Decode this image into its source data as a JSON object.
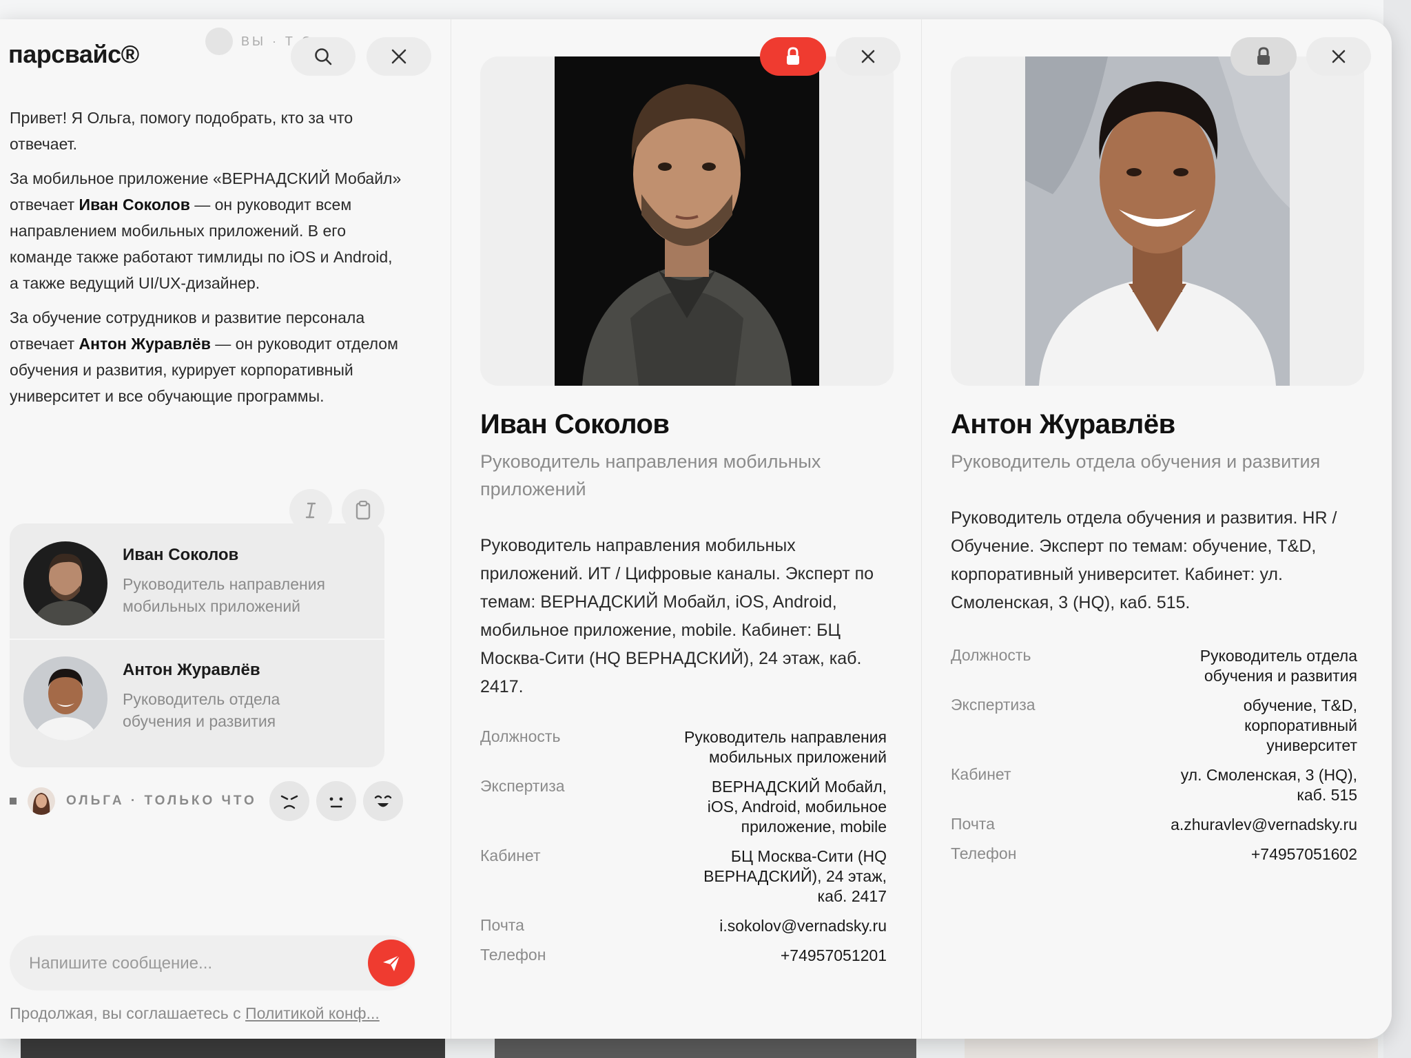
{
  "app": {
    "logo": "парсвайс®",
    "top_meta": "ВЫ · Т   О  ·"
  },
  "chat": {
    "messages": {
      "p1": "Привет! Я Ольга, помогу подобрать, кто за что отвечает.",
      "p2_a": "За мобильное приложение «ВЕРНАДСКИЙ Мобайл» отвечает ",
      "p2_b": "Иван Соколов",
      "p2_c": " — он руководит всем направлением мобильных приложений. В его команде также работают тимлиды по iOS и Android, а также ведущий UI/UX-дизайнер.",
      "p3_a": "За обучение сотрудников и развитие персонала отвечает ",
      "p3_b": "Антон Журавлёв",
      "p3_c": " — он руководит отделом обучения и развития, курирует корпоративный университет и все обучающие программы."
    },
    "cards": [
      {
        "name": "Иван Соколов",
        "role": "Руководитель направления мобильных приложений"
      },
      {
        "name": "Антон Журавлёв",
        "role": "Руководитель отдела обучения и развития"
      }
    ],
    "sender": "ОЛЬГА · ТОЛЬКО ЧТО",
    "input_placeholder": "Напишите сообщение...",
    "consent_text": "Продолжая, вы соглашаетесь с ",
    "consent_link": "Политикой конф..."
  },
  "profiles": [
    {
      "name": "Иван Соколов",
      "role": "Руководитель направления мобильных приложений",
      "description": "Руководитель направления мобильных приложений. ИТ / Цифровые каналы. Эксперт по темам: ВЕРНАДСКИЙ Мобайл, iOS, Android, мобильное приложение, mobile. Кабинет: БЦ Москва-Сити (HQ ВЕРНАДСКИЙ), 24 этаж, каб. 2417.",
      "fields": [
        {
          "label": "Должность",
          "value": "Руководитель направления мобильных приложений"
        },
        {
          "label": "Экспертиза",
          "value": "ВЕРНАДСКИЙ Мобайл, iOS, Android, мобильное приложение, mobile"
        },
        {
          "label": "Кабинет",
          "value": "БЦ Москва-Сити (HQ ВЕРНАДСКИЙ), 24 этаж, каб. 2417"
        },
        {
          "label": "Почта",
          "value": "i.sokolov@vernadsky.ru"
        },
        {
          "label": "Телефон",
          "value": "+74957051201"
        }
      ],
      "lock_color": "#ef3b30"
    },
    {
      "name": "Антон Журавлёв",
      "role": "Руководитель отдела обучения и развития",
      "description": "Руководитель отдела обучения и развития. HR / Обучение. Эксперт по темам: обучение, T&D, корпоративный университет. Кабинет: ул. Смоленская, 3 (HQ), каб. 515.",
      "fields": [
        {
          "label": "Должность",
          "value": "Руководитель отдела обучения и развития"
        },
        {
          "label": "Экспертиза",
          "value": "обучение, T&D, корпоративный университет"
        },
        {
          "label": "Кабинет",
          "value": "ул. Смоленская, 3 (HQ), каб. 515"
        },
        {
          "label": "Почта",
          "value": "a.zhuravlev@vernadsky.ru"
        },
        {
          "label": "Телефон",
          "value": "+74957051602"
        }
      ],
      "lock_color": "#dcdcdc"
    }
  ],
  "colors": {
    "accent": "#ef3b30",
    "panel_bg": "#f7f7f7",
    "muted_text": "#8b8b8b"
  },
  "icons": [
    "search-icon",
    "close-icon",
    "lock-icon",
    "text-cursor-icon",
    "clipboard-icon",
    "send-icon",
    "angry-emoji-icon",
    "neutral-emoji-icon",
    "happy-emoji-icon"
  ]
}
